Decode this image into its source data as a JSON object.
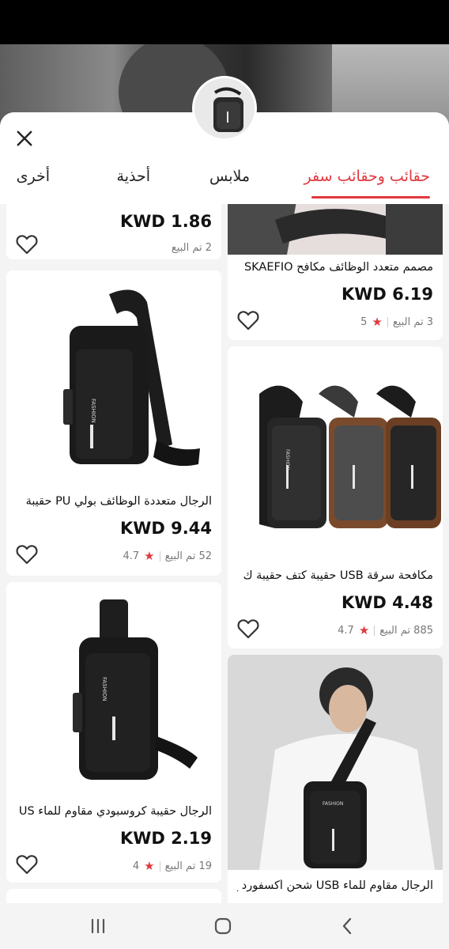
{
  "tabs": [
    {
      "label": "حقائب وحقائب سفر",
      "active": true
    },
    {
      "label": "ملابس",
      "active": false
    },
    {
      "label": "أحذية",
      "active": false
    },
    {
      "label": "أخرى",
      "active": false
    }
  ],
  "accent_color": "#e0393e",
  "products": {
    "left_top_partial": {
      "price": "KWD 1.86",
      "sold": "2 تم البيع"
    },
    "right_top": {
      "title": "مصمم متعدد الوظائف مكافح SKAEFIO",
      "price": "KWD 6.19",
      "sold": "3 تم البيع",
      "rating": "5"
    },
    "left_2": {
      "title": "الرجال متعددة الوظائف بولي PU حقيبة",
      "price": "KWD 9.44",
      "sold": "52 تم البيع",
      "rating": "4.7",
      "brand": "FASHION"
    },
    "right_2": {
      "title": "مكافحة سرقة USB حقيبة كتف حقيبة ك",
      "price": "KWD 4.48",
      "sold": "885 تم البيع",
      "rating": "4.7",
      "brand": "FASHION"
    },
    "left_3": {
      "title": "الرجال حقيبة كروسبودي مقاوم للماء US",
      "price": "KWD 2.19",
      "sold": "19 تم البيع",
      "rating": "4",
      "brand": "FASHION"
    },
    "right_3": {
      "title": "الرجال مقاوم للماء USB شحن أكسفورد ح",
      "brand": "FASHION"
    }
  },
  "icons": {
    "close": "close-icon",
    "heart": "heart-icon",
    "star": "star-icon",
    "nav_recents": "recents-icon",
    "nav_home": "home-icon",
    "nav_back": "back-icon"
  }
}
